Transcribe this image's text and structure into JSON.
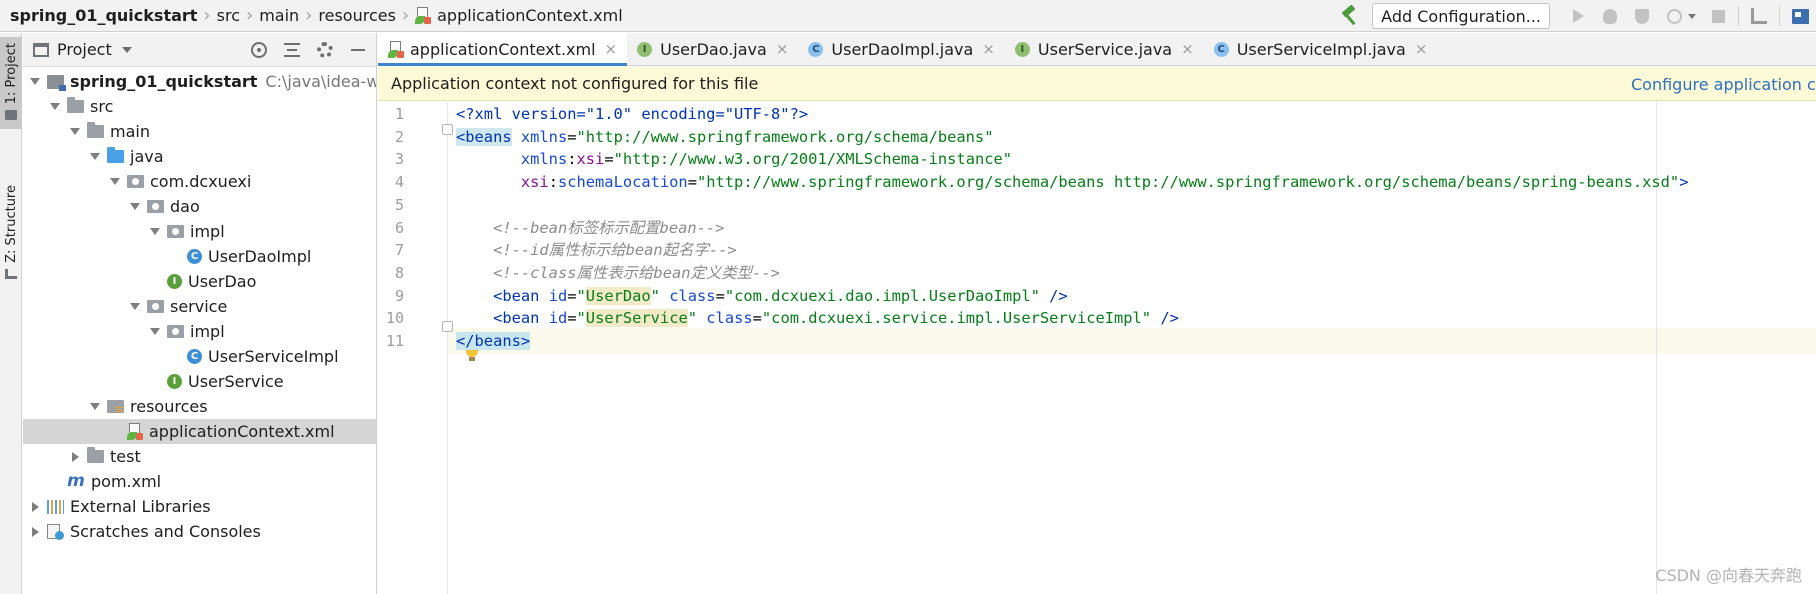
{
  "breadcrumb": {
    "items": [
      "spring_01_quickstart",
      "src",
      "main",
      "resources",
      "applicationContext.xml"
    ]
  },
  "toolbar": {
    "add_configuration_label": "Add Configuration..."
  },
  "tool_strip": {
    "project_label": "1: Project",
    "structure_label": "Z: Structure"
  },
  "project_panel": {
    "title": "Project",
    "tree": [
      {
        "label": "spring_01_quickstart",
        "path": "C:\\java\\idea-worksp",
        "icon": "module-icon",
        "toggle": "down",
        "depth": 0,
        "bold": true
      },
      {
        "label": "src",
        "icon": "folder-icon",
        "toggle": "down",
        "depth": 1
      },
      {
        "label": "main",
        "icon": "folder-icon",
        "toggle": "down",
        "depth": 2
      },
      {
        "label": "java",
        "icon": "source-folder-icon",
        "toggle": "down",
        "depth": 3
      },
      {
        "label": "com.dcxuexi",
        "icon": "package-icon",
        "toggle": "down",
        "depth": 4
      },
      {
        "label": "dao",
        "icon": "package-icon",
        "toggle": "down",
        "depth": 5
      },
      {
        "label": "impl",
        "icon": "package-icon",
        "toggle": "down",
        "depth": 6
      },
      {
        "label": "UserDaoImpl",
        "icon": "class-icon",
        "toggle": "none",
        "depth": 7
      },
      {
        "label": "UserDao",
        "icon": "interface-icon",
        "toggle": "none",
        "depth": 6
      },
      {
        "label": "service",
        "icon": "package-icon",
        "toggle": "down",
        "depth": 5
      },
      {
        "label": "impl",
        "icon": "package-icon",
        "toggle": "down",
        "depth": 6
      },
      {
        "label": "UserServiceImpl",
        "icon": "class-icon",
        "toggle": "none",
        "depth": 7
      },
      {
        "label": "UserService",
        "icon": "interface-icon",
        "toggle": "none",
        "depth": 6
      },
      {
        "label": "resources",
        "icon": "resources-folder-icon",
        "toggle": "down",
        "depth": 3
      },
      {
        "label": "applicationContext.xml",
        "icon": "xml-file-icon",
        "toggle": "none",
        "depth": 4,
        "selected": true
      },
      {
        "label": "test",
        "icon": "folder-icon",
        "toggle": "right",
        "depth": 2
      },
      {
        "label": "pom.xml",
        "icon": "maven-icon",
        "toggle": "none",
        "depth": 1
      },
      {
        "label": "External Libraries",
        "icon": "libraries-icon",
        "toggle": "right",
        "depth": 0
      },
      {
        "label": "Scratches and Consoles",
        "icon": "scratches-icon",
        "toggle": "right",
        "depth": 0
      }
    ]
  },
  "editor_tabs": [
    {
      "label": "applicationContext.xml",
      "icon": "xml-file-icon",
      "active": true
    },
    {
      "label": "UserDao.java",
      "icon": "interface-icon"
    },
    {
      "label": "UserDaoImpl.java",
      "icon": "class-icon"
    },
    {
      "label": "UserService.java",
      "icon": "interface-icon"
    },
    {
      "label": "UserServiceImpl.java",
      "icon": "class-icon"
    }
  ],
  "banner": {
    "message": "Application context not configured for this file",
    "link": "Configure application con"
  },
  "editor": {
    "line_numbers": [
      "1",
      "2",
      "3",
      "4",
      "5",
      "6",
      "7",
      "8",
      "9",
      "10",
      "11"
    ],
    "lines": [
      {
        "indent": "",
        "segments": [
          {
            "t": "<?xml version=\"1.0\" encoding=\"UTF-8\"?>",
            "c": "x-tag"
          }
        ]
      },
      {
        "indent": "",
        "segments": [
          {
            "t": "<beans",
            "c": "x-tag x-hl"
          },
          {
            "t": " xmlns",
            "c": "x-attr"
          },
          {
            "t": "=",
            "c": ""
          },
          {
            "t": "\"http://www.springframework.org/schema/beans\"",
            "c": "x-str"
          }
        ]
      },
      {
        "indent": "       ",
        "segments": [
          {
            "t": "xmlns",
            "c": "x-attr"
          },
          {
            "t": ":",
            "c": ""
          },
          {
            "t": "xsi",
            "c": "x-ns"
          },
          {
            "t": "=",
            "c": ""
          },
          {
            "t": "\"http://www.w3.org/2001/XMLSchema-instance\"",
            "c": "x-str"
          }
        ]
      },
      {
        "indent": "       ",
        "segments": [
          {
            "t": "xsi",
            "c": "x-ns"
          },
          {
            "t": ":",
            "c": ""
          },
          {
            "t": "schemaLocation",
            "c": "x-attr"
          },
          {
            "t": "=",
            "c": ""
          },
          {
            "t": "\"http://www.springframework.org/schema/beans http://www.springframework.org/schema/beans/spring-beans.xsd\"",
            "c": "x-str"
          },
          {
            "t": ">",
            "c": "x-tag"
          }
        ]
      },
      {
        "indent": "",
        "segments": []
      },
      {
        "indent": "    ",
        "segments": [
          {
            "t": "<!--bean标签标示配置bean-->",
            "c": "x-cmt"
          }
        ]
      },
      {
        "indent": "    ",
        "segments": [
          {
            "t": "<!--id属性标示给bean起名字-->",
            "c": "x-cmt"
          }
        ]
      },
      {
        "indent": "    ",
        "segments": [
          {
            "t": "<!--class属性表示给bean定义类型-->",
            "c": "x-cmt"
          }
        ]
      },
      {
        "indent": "    ",
        "segments": [
          {
            "t": "<bean",
            "c": "x-tag"
          },
          {
            "t": " id",
            "c": "x-attr"
          },
          {
            "t": "=",
            "c": ""
          },
          {
            "t": "\"",
            "c": "x-str"
          },
          {
            "t": "UserDao",
            "c": "x-str x-ref"
          },
          {
            "t": "\"",
            "c": "x-str"
          },
          {
            "t": " class",
            "c": "x-attr"
          },
          {
            "t": "=",
            "c": ""
          },
          {
            "t": "\"com.dcxuexi.dao.impl.UserDaoImpl\"",
            "c": "x-str"
          },
          {
            "t": " />",
            "c": "x-tag"
          }
        ]
      },
      {
        "indent": "    ",
        "segments": [
          {
            "t": "<bean",
            "c": "x-tag"
          },
          {
            "t": " id",
            "c": "x-attr"
          },
          {
            "t": "=",
            "c": ""
          },
          {
            "t": "\"",
            "c": "x-str"
          },
          {
            "t": "UserService",
            "c": "x-str x-ref"
          },
          {
            "t": "\"",
            "c": "x-str"
          },
          {
            "t": " class",
            "c": "x-attr"
          },
          {
            "t": "=",
            "c": ""
          },
          {
            "t": "\"com.dcxuexi.service.impl.UserServiceImpl\"",
            "c": "x-str"
          },
          {
            "t": " />",
            "c": "x-tag"
          }
        ]
      },
      {
        "indent": "",
        "segments": [
          {
            "t": "</beans",
            "c": "x-tag x-bracket"
          },
          {
            "t": ">",
            "c": "x-tag x-bracket"
          }
        ]
      }
    ]
  },
  "watermark": "CSDN @向春天奔跑"
}
